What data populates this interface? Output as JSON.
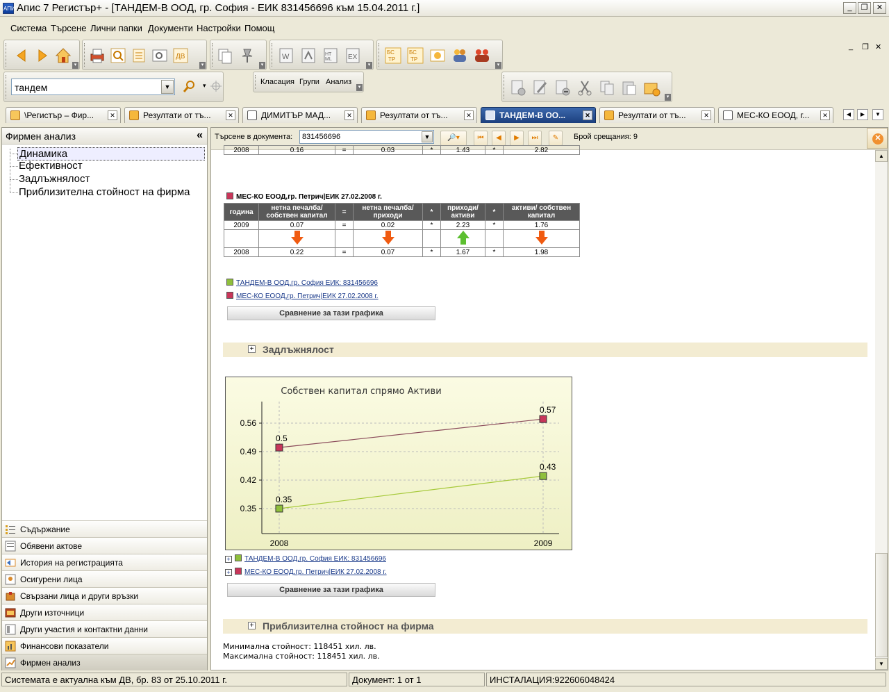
{
  "window": {
    "title": "Апис 7 Регистър+ - [ТАНДЕМ-В ООД, гр. София - ЕИК 831456696 към  15.04.2011 г.]",
    "app_icon_text": "АПИС"
  },
  "menu": [
    "Система",
    "Търсене",
    "Лични папки",
    "Документи",
    "Настройки",
    "Помощ"
  ],
  "search": {
    "value": "тандем"
  },
  "toolbar": {
    "group_labels": [
      "Класация",
      "Групи",
      "Анализ"
    ]
  },
  "tabs": [
    {
      "label": "\\Регистър – Фир...",
      "icon": "folder-icon",
      "active": false
    },
    {
      "label": "Резултати от тъ...",
      "icon": "search-result-icon",
      "active": false
    },
    {
      "label": "ДИМИТЪР МАД...",
      "icon": "document-icon",
      "active": false
    },
    {
      "label": "Резултати от тъ...",
      "icon": "search-result-icon",
      "active": false
    },
    {
      "label": "ТАНДЕМ-В ОО...",
      "icon": "document-icon",
      "active": true
    },
    {
      "label": "Резултати от тъ...",
      "icon": "search-result-icon",
      "active": false
    },
    {
      "label": "МЕС-КО ЕООД, г...",
      "icon": "document-icon",
      "active": false
    }
  ],
  "left_panel": {
    "title": "Фирмен анализ",
    "collapse_glyph": "«",
    "tree": [
      "Динамика",
      "Ефективност",
      "Задлъжнялост",
      "Приблизителна стойност на фирма"
    ],
    "nav": [
      "Съдържание",
      "Обявени актове",
      "История на регистрацията",
      "Осигурени лица",
      "Свързани лица и други връзки",
      "Други източници",
      "Други участия и контактни данни",
      "Финансови показатели",
      "Фирмен анализ"
    ]
  },
  "findbar": {
    "label": "Търсене в документа:",
    "value": "831456696",
    "matches": "Брой срещания: 9"
  },
  "table_top": {
    "row": [
      "2008",
      "0.16",
      "=",
      "0.03",
      "*",
      "1.43",
      "*",
      "2.82"
    ]
  },
  "table_company": "МЕС-КО ЕООД,гр. Петрич|ЕИК 27.02.2008 г.",
  "table_headers": [
    "година",
    "нетна печалба/ собствен капитал",
    "=",
    "нетна печалба/ приходи",
    "*",
    "приходи/ активи",
    "*",
    "активи/ собствен капитал"
  ],
  "table_rows": [
    [
      "2009",
      "0.07",
      "=",
      "0.02",
      "*",
      "2.23",
      "*",
      "1.76"
    ],
    [
      "2008",
      "0.22",
      "=",
      "0.07",
      "*",
      "1.67",
      "*",
      "1.98"
    ]
  ],
  "legend_links": [
    "ТАНДЕМ-В ООД,гр. София ЕИК: 831456696",
    "МЕС-КО ЕООД,гр. Петрич|ЕИК 27.02.2008 г."
  ],
  "compare_button": "Сравнение за тази графика",
  "sections": [
    "Задлъжнялост",
    "Приблизителна стойност на фирма"
  ],
  "chart_data": {
    "type": "line",
    "title": "Собствен капитал спрямо Активи",
    "x": [
      "2008",
      "2009"
    ],
    "yticks": [
      "0.56",
      "0.49",
      "0.42",
      "0.35"
    ],
    "ylim": [
      0.3,
      0.6
    ],
    "series": [
      {
        "name": "МЕС-КО ЕООД,гр. Петрич|ЕИК 27.02.2008 г.",
        "values": [
          0.5,
          0.57
        ],
        "labels": [
          "0.5",
          "0.57"
        ],
        "color": "#c8365a",
        "line": "#8a4a5a"
      },
      {
        "name": "ТАНДЕМ-В ООД,гр. София ЕИК: 831456696",
        "values": [
          0.35,
          0.43
        ],
        "labels": [
          "0.35",
          "0.43"
        ],
        "color": "#8fbf3c",
        "line": "#a6c93a"
      }
    ],
    "grid": true
  },
  "colors": {
    "green": "#8fbf3c",
    "red": "#c8365a",
    "orange_arrow": "#f05a10",
    "green_arrow": "#5cbf30"
  },
  "values": {
    "min": "Минимална стойност: 118451 хил. лв.",
    "max": "Максимална стойност: 118451 хил. лв."
  },
  "status": {
    "left": "Системата е актуална към ДВ, бр. 83 от 25.10.2011 г.",
    "doc": "Документ:  1 от 1",
    "install": "ИНСТАЛАЦИЯ:922606048424"
  }
}
